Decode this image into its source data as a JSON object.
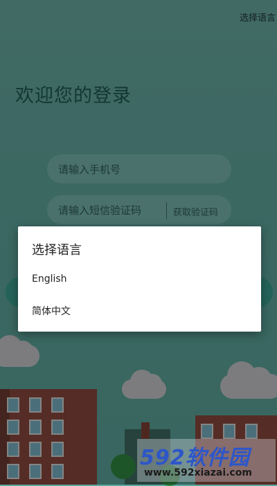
{
  "header": {
    "language_link": "选择语言"
  },
  "main": {
    "welcome_title": "欢迎您的登录",
    "phone_placeholder": "请输入手机号",
    "code_placeholder": "请输入短信验证码",
    "get_code_label": "获取验证码"
  },
  "dialog": {
    "title": "选择语言",
    "options": [
      "English",
      "简体中文"
    ]
  },
  "watermark": {
    "logo_text": "592软件园",
    "url_text": "www.592xiazai.com"
  },
  "colors": {
    "background": "#5aa9a0",
    "accent": "#3aa192",
    "dialog": "#ffffff",
    "watermark_logo": "#2d56c8"
  }
}
